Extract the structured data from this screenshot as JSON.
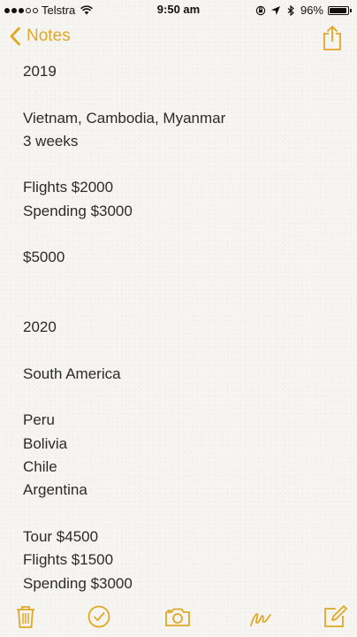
{
  "status_bar": {
    "carrier": "Telstra",
    "time": "9:50 am",
    "battery": "96%",
    "battery_level": 0.96,
    "signal_bars": 3,
    "signal_total": 5
  },
  "nav": {
    "back_label": "Notes",
    "accent_color": "#e0a824"
  },
  "note": {
    "lines": [
      "2019",
      "",
      "Vietnam, Cambodia, Myanmar",
      "3 weeks",
      "",
      "Flights $2000",
      "Spending $3000",
      "",
      "$5000",
      "",
      "",
      "2020",
      "",
      "South America",
      "",
      "Peru",
      "Bolivia",
      "Chile",
      "Argentina",
      "",
      "Tour $4500",
      "Flights $1500",
      "Spending $3000"
    ]
  },
  "toolbar": {
    "icons": [
      "trash-icon",
      "checklist-icon",
      "camera-icon",
      "sketch-icon",
      "compose-icon"
    ]
  }
}
